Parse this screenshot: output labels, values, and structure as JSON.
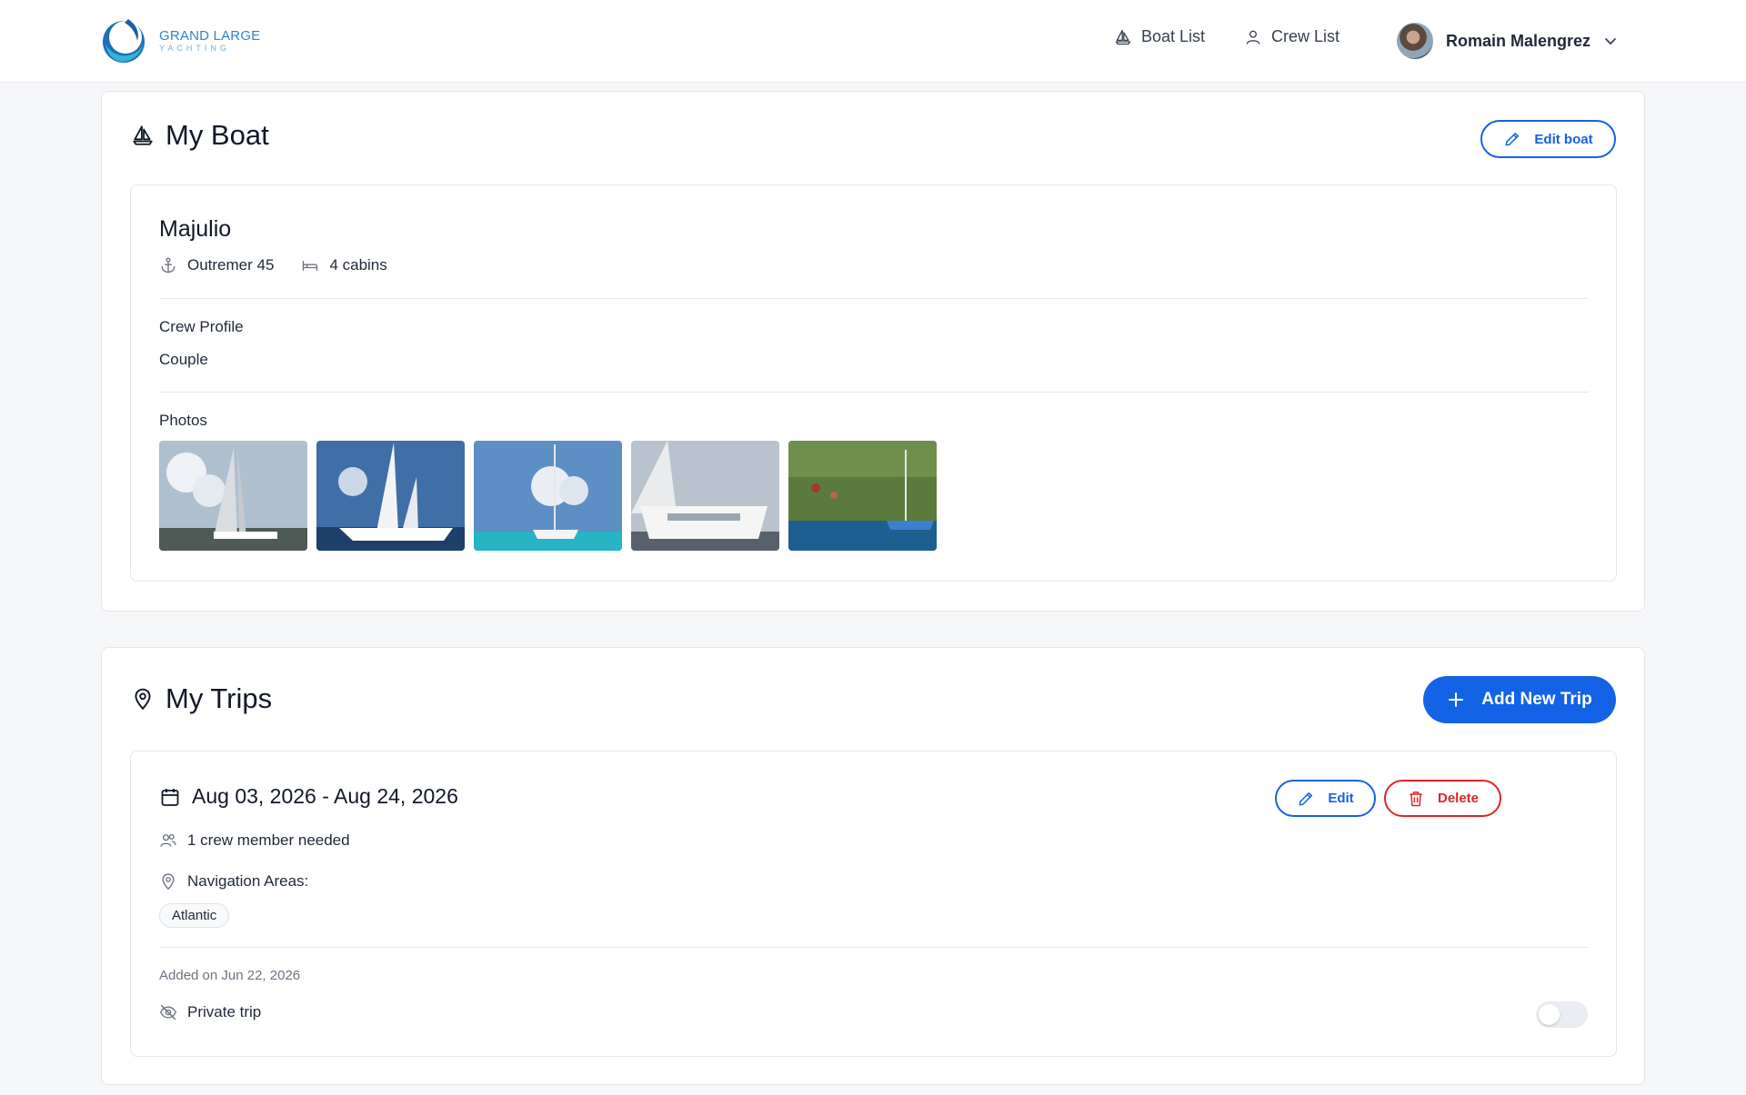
{
  "header": {
    "logo": {
      "line1": "GRAND LARGE",
      "line2": "YACHTING"
    },
    "nav": [
      {
        "label": "Boat List",
        "icon": "sailboat-icon"
      },
      {
        "label": "Crew List",
        "icon": "user-icon"
      }
    ],
    "user": {
      "name": "Romain Malengrez"
    }
  },
  "boat_section": {
    "title": "My Boat",
    "edit_label": "Edit boat",
    "boat": {
      "name": "Majulio",
      "model": "Outremer 45",
      "cabins": "4 cabins",
      "crew_profile_label": "Crew Profile",
      "crew_profile_value": "Couple",
      "photos_label": "Photos",
      "photos": [
        "boat-photo-1",
        "boat-photo-2",
        "boat-photo-3",
        "boat-photo-4",
        "boat-photo-5"
      ]
    }
  },
  "trips_section": {
    "title": "My Trips",
    "add_label": "Add New Trip",
    "trip": {
      "dates": "Aug 03, 2026 - Aug 24, 2026",
      "crew_needed": "1 crew member needed",
      "nav_areas_label": "Navigation Areas:",
      "areas": [
        "Atlantic"
      ],
      "added": "Added on Jun 22, 2026",
      "private_label": "Private trip",
      "private_enabled": false,
      "edit_label": "Edit",
      "delete_label": "Delete"
    }
  },
  "colors": {
    "primary": "#1463e6",
    "danger": "#dc2626",
    "background": "#f6f7f9"
  }
}
